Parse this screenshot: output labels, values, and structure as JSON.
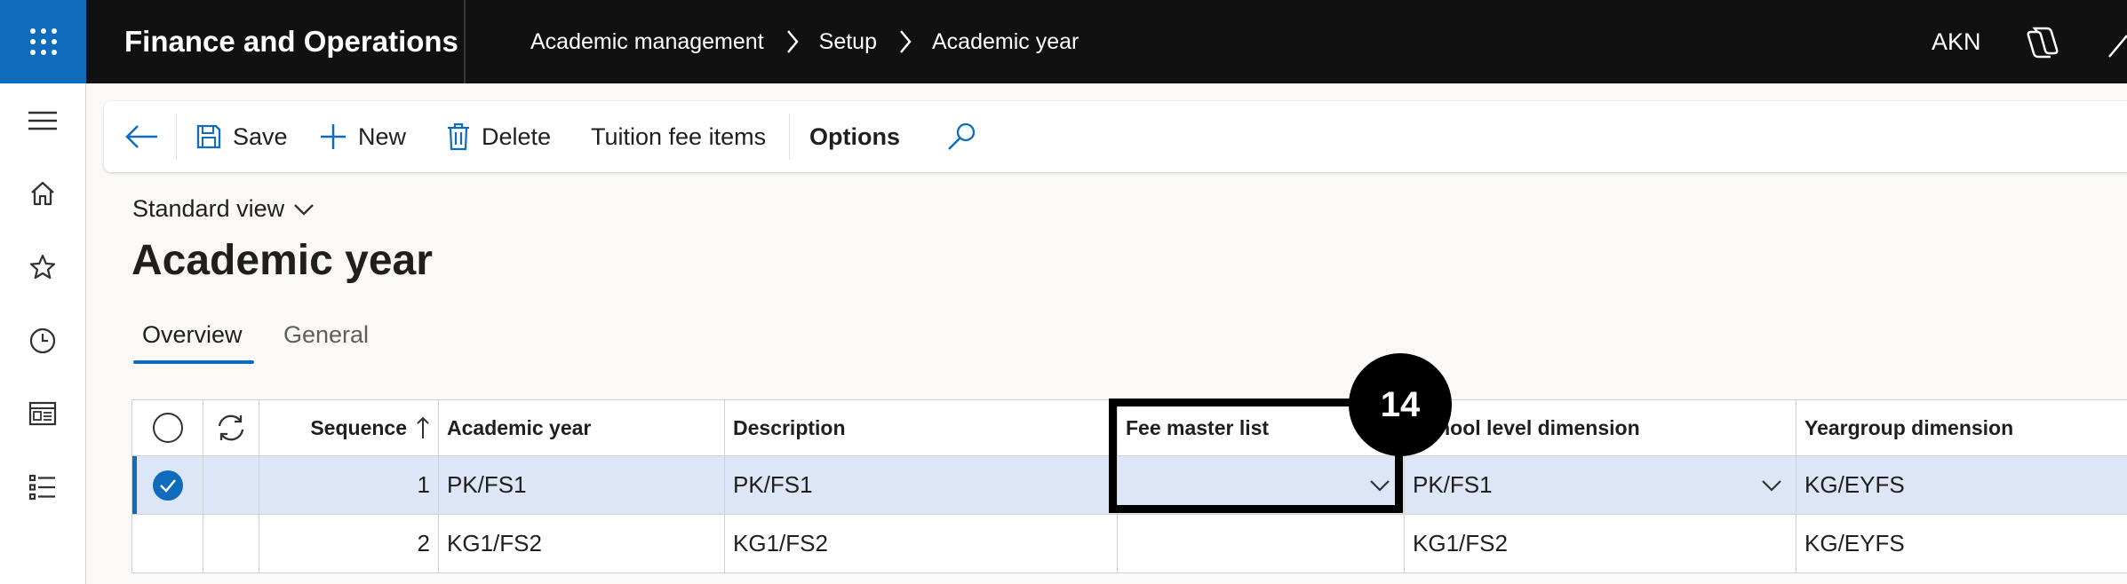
{
  "topbar": {
    "app_title": "Finance and Operations",
    "breadcrumb": [
      "Academic management",
      "Setup",
      "Academic year"
    ],
    "user_initials": "AKN"
  },
  "leftnav": {
    "icons": [
      "hamburger-icon",
      "home-icon",
      "star-icon",
      "clock-icon",
      "workspace-icon",
      "list-icon"
    ]
  },
  "actionpane": {
    "save_label": "Save",
    "new_label": "New",
    "delete_label": "Delete",
    "tuition_label": "Tuition fee items",
    "options_label": "Options"
  },
  "page": {
    "view_label": "Standard view",
    "title": "Academic year"
  },
  "tabs": [
    {
      "label": "Overview",
      "active": true
    },
    {
      "label": "General",
      "active": false
    }
  ],
  "grid": {
    "columns": [
      "Sequence",
      "Academic year",
      "Description",
      "Fee master list",
      "School level dimension",
      "Yeargroup dimension"
    ],
    "rows": [
      {
        "sequence": "1",
        "academic_year": "PK/FS1",
        "description": "PK/FS1",
        "fee_master_list": "",
        "school_level": "PK/FS1",
        "yeargroup": "KG/EYFS",
        "selected": true
      },
      {
        "sequence": "2",
        "academic_year": "KG1/FS2",
        "description": "KG1/FS2",
        "fee_master_list": "",
        "school_level": "KG1/FS2",
        "yeargroup": "KG/EYFS",
        "selected": false
      }
    ]
  },
  "callout": {
    "number": "14"
  },
  "colors": {
    "accent": "#0f6cbd",
    "topbar": "#111111",
    "selected_row": "#dce6f7"
  }
}
